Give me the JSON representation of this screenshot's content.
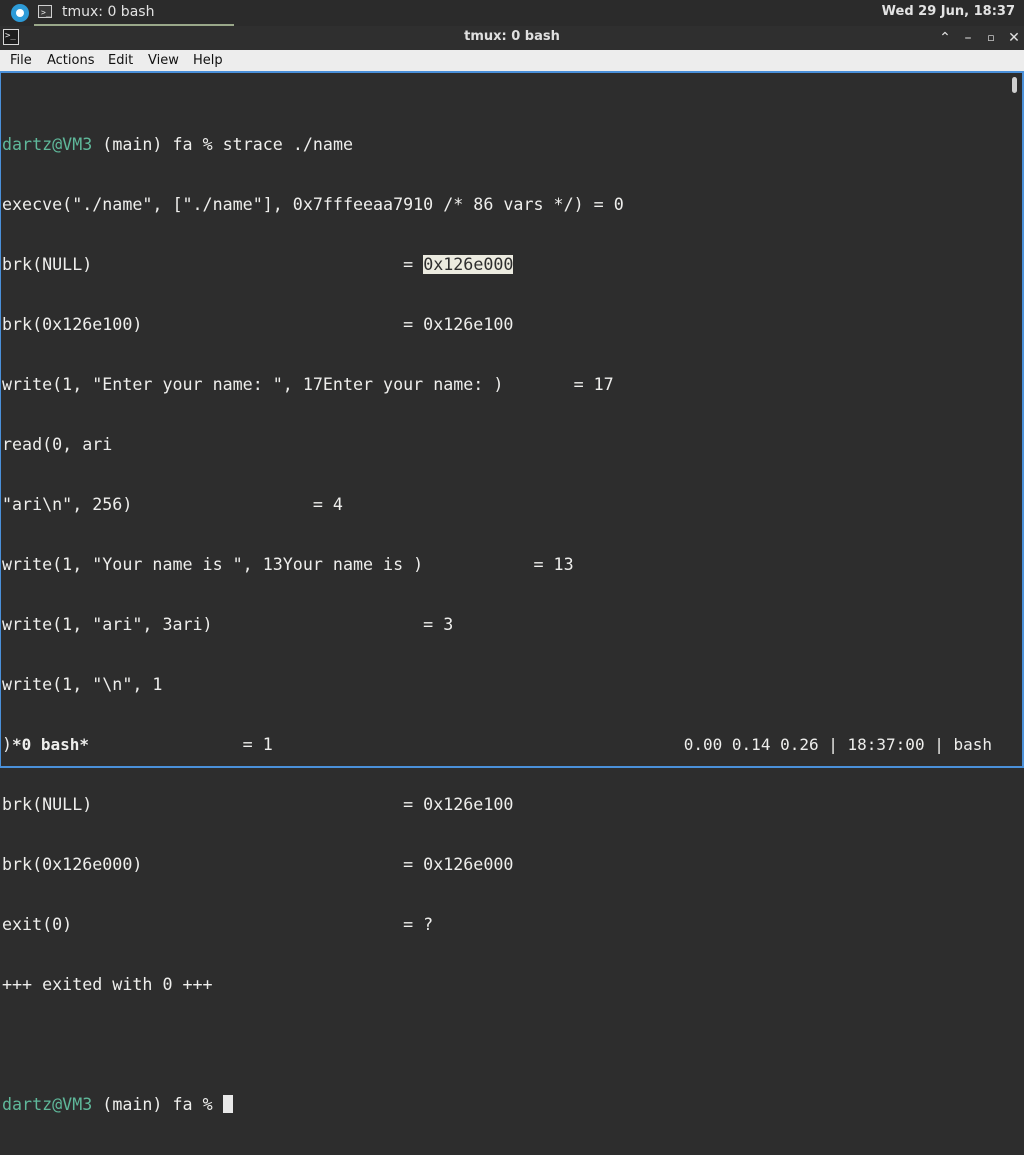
{
  "panel": {
    "app_menu_icon": "debian-swirl-icon",
    "task_label": "tmux: 0 bash",
    "clock": "Wed 29 Jun, 18:37"
  },
  "window": {
    "title": "tmux: 0 bash",
    "icon": "terminal-icon",
    "controls": [
      "shade-up-icon",
      "minimize-icon",
      "maximize-icon",
      "close-icon"
    ]
  },
  "menubar": {
    "items": [
      "File",
      "Actions",
      "Edit",
      "View",
      "Help"
    ]
  },
  "terminal": {
    "prompt": {
      "user_host": "dartz@VM3",
      "rest": " (main) fa % "
    },
    "command": "strace ./name",
    "lines": [
      "execve(\"./name\", [\"./name\"], 0x7fffeeaa7910 /* 86 vars */) = 0",
      "brk(0x126e100)                          = 0x126e100",
      "write(1, \"Enter your name: \", 17Enter your name: )       = 17",
      "read(0, ari",
      "\"ari\\n\", 256)                  = 4",
      "write(1, \"Your name is \", 13Your name is )           = 13",
      "write(1, \"ari\", 3ari)                     = 3",
      "write(1, \"\\n\", 1",
      ")                       = 1",
      "brk(NULL)                               = 0x126e100",
      "brk(0x126e000)                          = 0x126e000",
      "exit(0)                                 = ?",
      "+++ exited with 0 +++"
    ],
    "brk_null_prefix": "brk(NULL)                               = ",
    "highlighted_value": "0x126e000"
  },
  "tmux_status": {
    "left": "*0 bash*",
    "right": "0.00 0.14 0.26 | 18:37:00 | bash"
  },
  "colors": {
    "prompt_user": "#5fb89a",
    "background": "#2d2d2d",
    "foreground": "#eeeeec",
    "selection": "#ecebe0",
    "accent": "#4a90d9"
  }
}
